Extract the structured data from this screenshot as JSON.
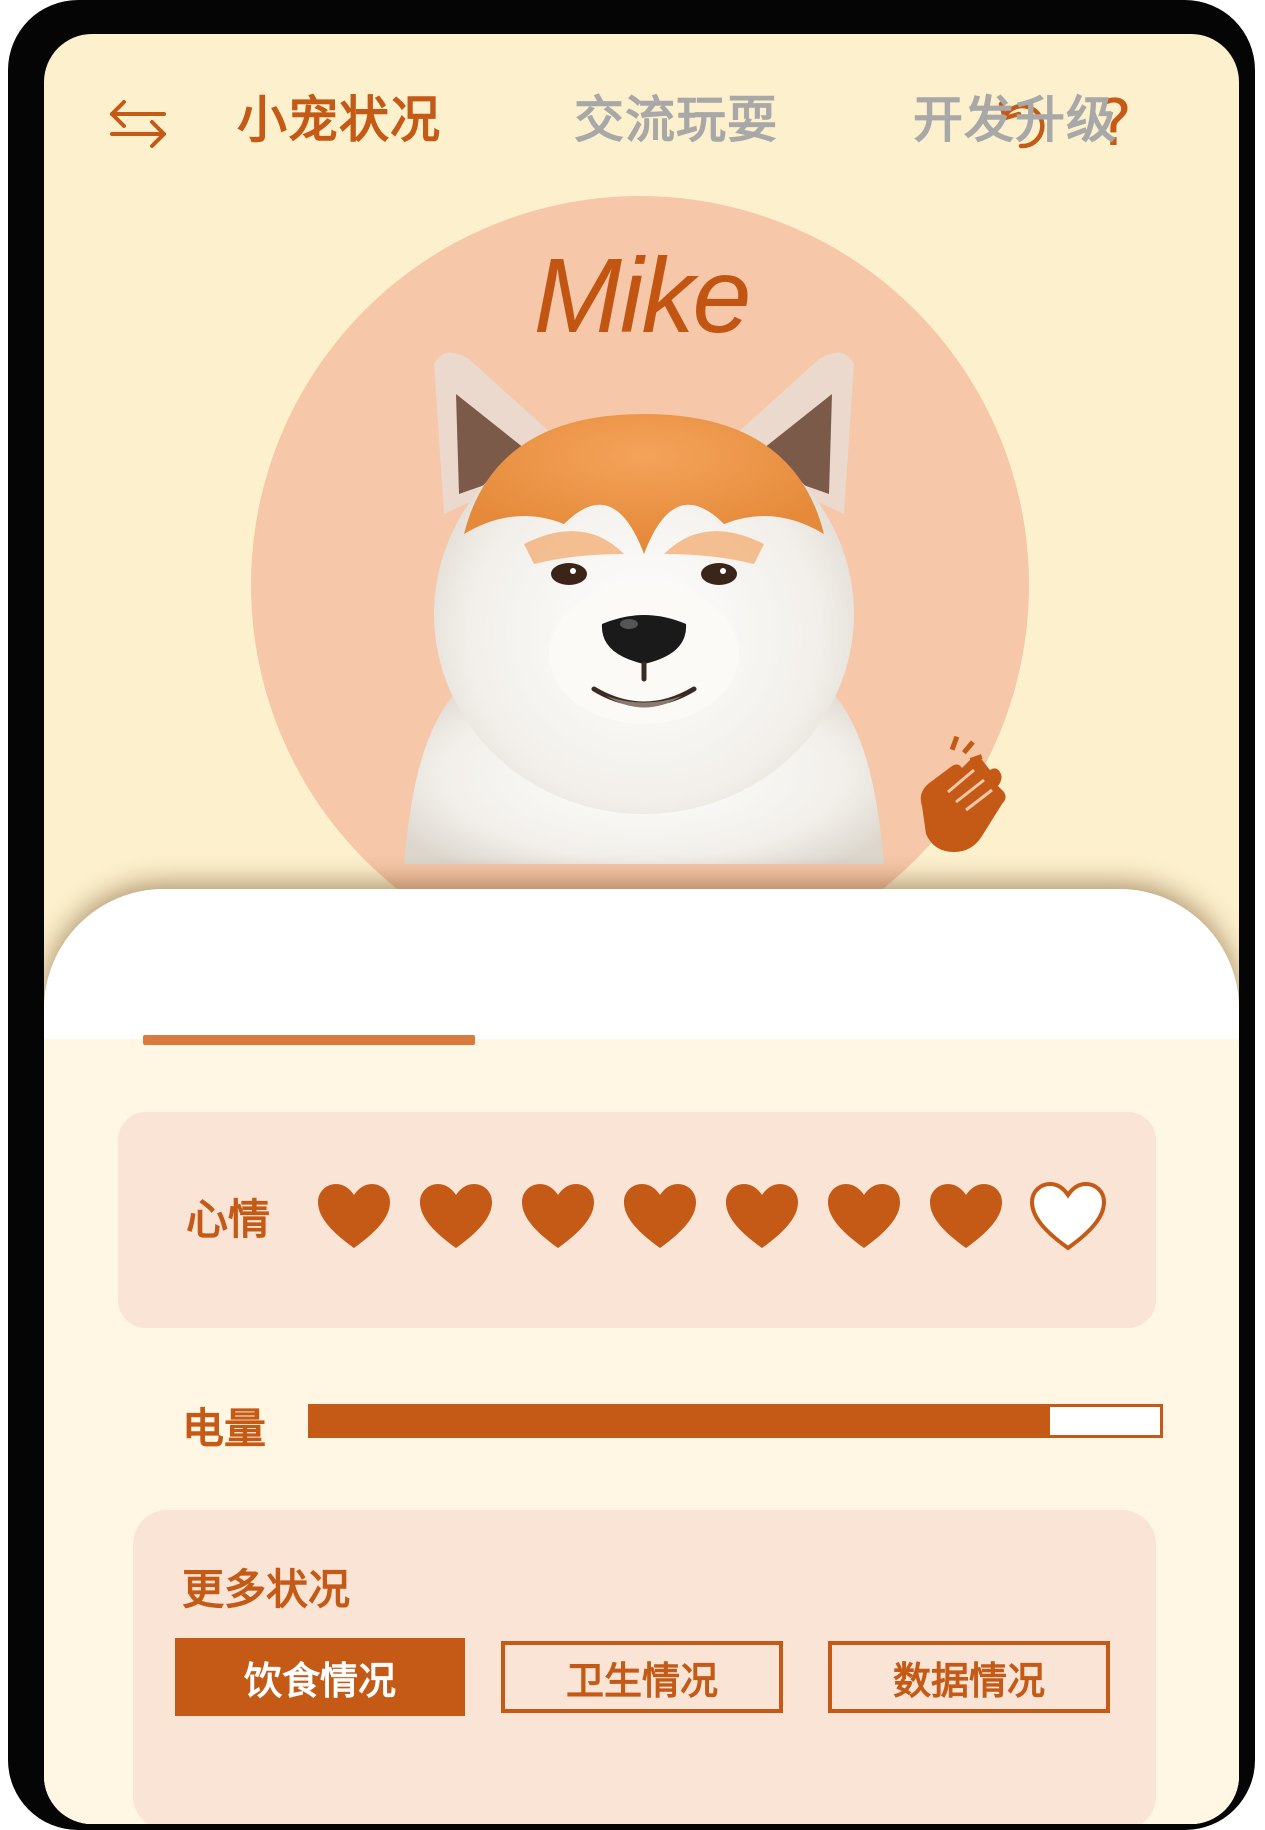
{
  "topbar": {
    "left_icon": "switch-arrows-icon",
    "right_icons": [
      "undo-icon",
      "help-icon"
    ],
    "help_glyph": "?"
  },
  "pet": {
    "name": "Mike",
    "image": "akita-dog-portrait",
    "action_icon": "clapping-hands-icon"
  },
  "tabs": [
    {
      "label": "小宠状况",
      "active": true
    },
    {
      "label": "交流玩耍",
      "active": false
    },
    {
      "label": "开发升级",
      "active": false
    }
  ],
  "mood": {
    "label": "心情",
    "filled": 7,
    "total": 8
  },
  "battery": {
    "label": "电量",
    "level": 0.87
  },
  "more": {
    "label": "更多状况",
    "buttons": [
      {
        "label": "饮食情况",
        "active": true
      },
      {
        "label": "卫生情况",
        "active": false
      },
      {
        "label": "数据情况",
        "active": false
      }
    ]
  },
  "colors": {
    "accent": "#c45a16",
    "background": "#fdf0cc",
    "circle": "#f6c7a8",
    "card": "#f9e4d6",
    "inactive_tab": "#a8a8a8"
  }
}
